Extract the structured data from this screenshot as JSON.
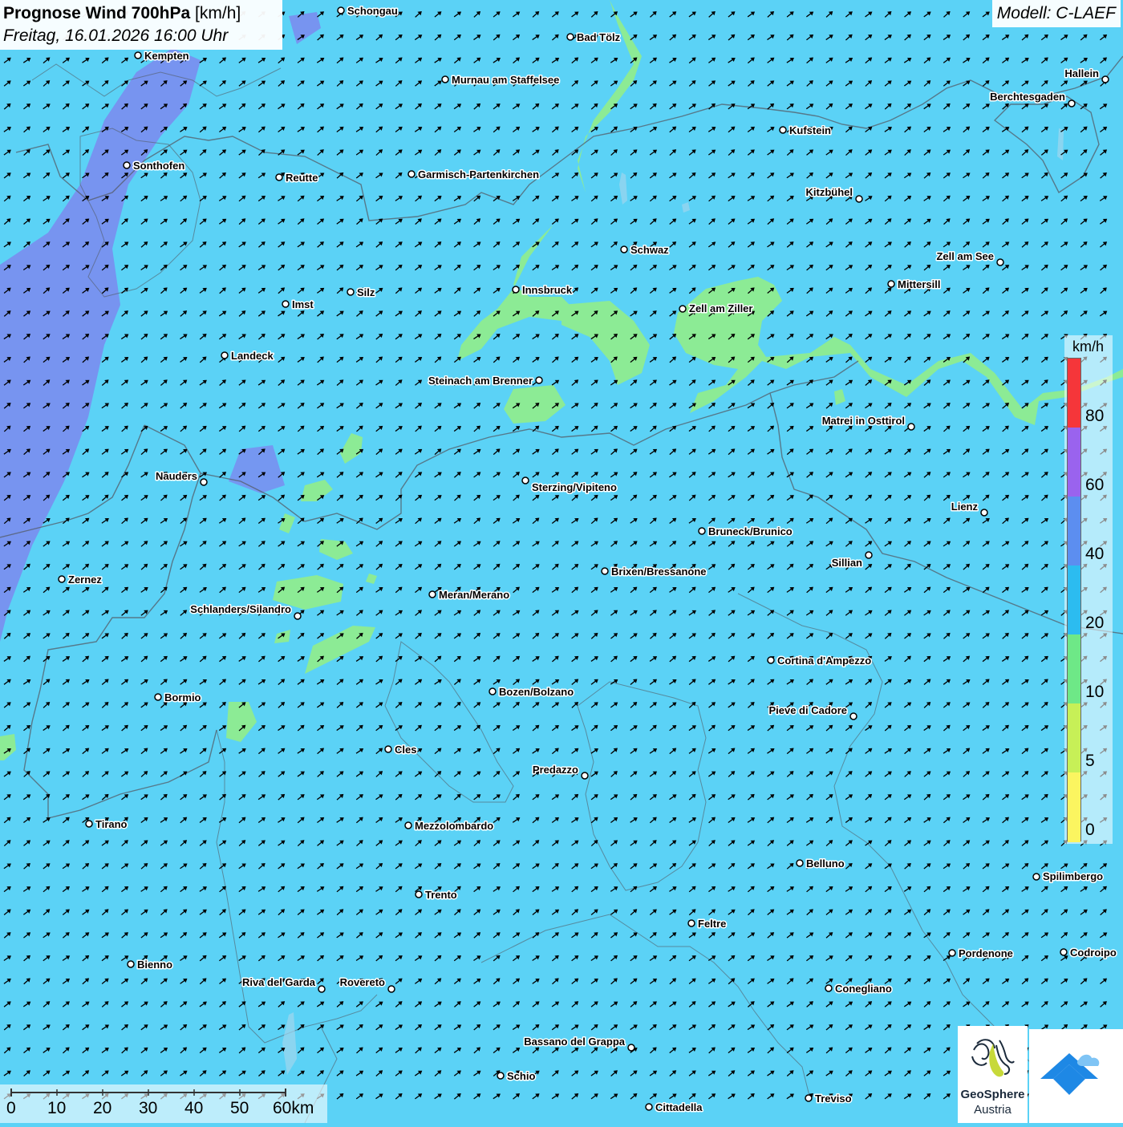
{
  "header": {
    "title_bold": "Prognose Wind 700hPa",
    "title_unit": "[km/h]",
    "subtitle": "Freitag, 16.01.2026 16:00 Uhr",
    "model": "Modell: C-LAEF"
  },
  "legend": {
    "unit": "km/h",
    "labels": [
      "80",
      "60",
      "40",
      "20",
      "10",
      "5",
      "0"
    ],
    "colors": [
      "#f5363a",
      "#9a63ee",
      "#5c8ef0",
      "#2cbcf0",
      "#6ee887",
      "#c7f057",
      "#fbf560"
    ]
  },
  "colors": {
    "wind_20_40": "#5bd2f6",
    "wind_10_20": "#8ceb95",
    "wind_40_60": "#7a8df0",
    "arrow": "#000000"
  },
  "cities": [
    {
      "name": "Schongau"
    },
    {
      "name": "Bad Tölz"
    },
    {
      "name": "Kempten"
    },
    {
      "name": "Murnau am Staffelsee"
    },
    {
      "name": "Hallein"
    },
    {
      "name": "Berchtesgaden"
    },
    {
      "name": "Kufstein"
    },
    {
      "name": "Sonthofen"
    },
    {
      "name": "Reutte"
    },
    {
      "name": "Garmisch-Partenkirchen"
    },
    {
      "name": "Kitzbühel"
    },
    {
      "name": "Schwaz"
    },
    {
      "name": "Zell am See"
    },
    {
      "name": "Mittersill"
    },
    {
      "name": "Silz"
    },
    {
      "name": "Innsbruck"
    },
    {
      "name": "Imst"
    },
    {
      "name": "Zell am Ziller"
    },
    {
      "name": "Landeck"
    },
    {
      "name": "Steinach am Brenner"
    },
    {
      "name": "Matrei in Osttirol"
    },
    {
      "name": "Nauders"
    },
    {
      "name": "Sterzing/Vipiteno"
    },
    {
      "name": "Lienz"
    },
    {
      "name": "Bruneck/Brunico"
    },
    {
      "name": "Sillian"
    },
    {
      "name": "Brixen/Bressanone"
    },
    {
      "name": "Zernez"
    },
    {
      "name": "Meran/Merano"
    },
    {
      "name": "Schlanders/Silandro"
    },
    {
      "name": "Cortina d'Ampezzo"
    },
    {
      "name": "Bozen/Bolzano"
    },
    {
      "name": "Bormio"
    },
    {
      "name": "Pieve di Cadore"
    },
    {
      "name": "Cles"
    },
    {
      "name": "Predazzo"
    },
    {
      "name": "Tirano"
    },
    {
      "name": "Mezzolombardo"
    },
    {
      "name": "Belluno"
    },
    {
      "name": "Spilimbergo"
    },
    {
      "name": "Trento"
    },
    {
      "name": "Feltre"
    },
    {
      "name": "Pordenone"
    },
    {
      "name": "Codroipo"
    },
    {
      "name": "Bienno"
    },
    {
      "name": "Riva del Garda"
    },
    {
      "name": "Rovereto"
    },
    {
      "name": "Conegliano"
    },
    {
      "name": "Bassano del Grappa"
    },
    {
      "name": "Schio"
    },
    {
      "name": "Treviso"
    },
    {
      "name": "Cittadella"
    }
  ],
  "scalebar": {
    "labels": [
      "0",
      "10",
      "20",
      "30",
      "40",
      "50",
      "60km"
    ]
  },
  "logos": {
    "geosphere_name": "GeoSphere",
    "geosphere_sub": "Austria"
  }
}
